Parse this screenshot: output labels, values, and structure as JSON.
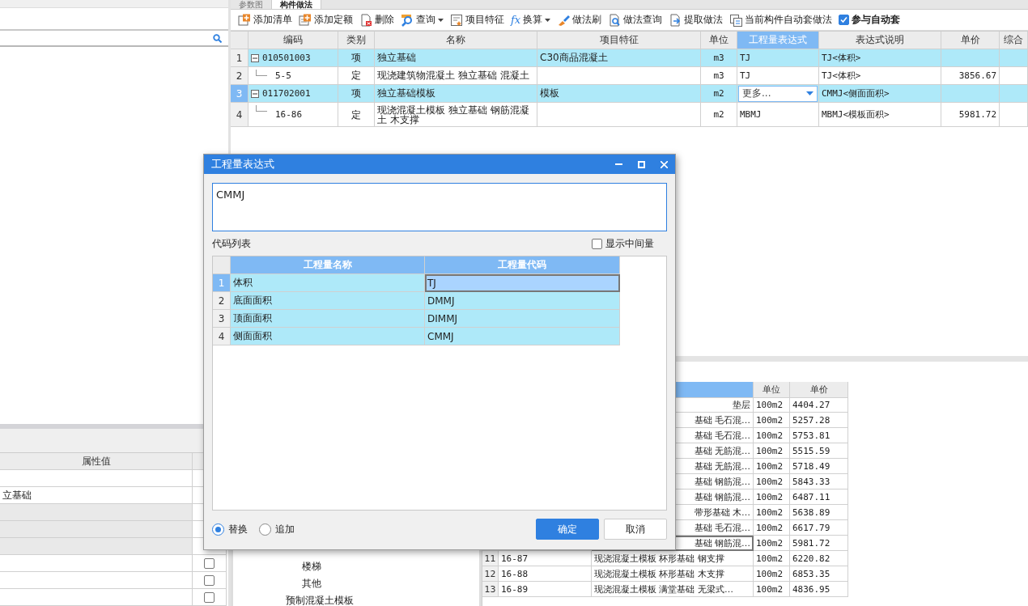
{
  "left_panel": {
    "property_table": {
      "columns": [
        {
          "label": "属性值"
        }
      ],
      "rows": [
        {
          "kind": "plain"
        },
        {
          "kind": "text",
          "value": "立基础"
        },
        {
          "kind": "shaded"
        },
        {
          "kind": "shaded"
        },
        {
          "kind": "shaded"
        },
        {
          "kind": "checkbox",
          "checked": false
        },
        {
          "kind": "checkbox",
          "checked": false
        },
        {
          "kind": "checkbox",
          "checked": false
        }
      ]
    }
  },
  "tabs": [
    {
      "label": "参数图",
      "selected": false
    },
    {
      "label": "构件做法",
      "selected": true
    }
  ],
  "toolbar": [
    {
      "label": "添加清单",
      "kind": "button"
    },
    {
      "label": "添加定额",
      "kind": "button"
    },
    {
      "label": "删除",
      "kind": "button"
    },
    {
      "label": "查询",
      "kind": "dropdown"
    },
    {
      "label": "项目特征",
      "kind": "button"
    },
    {
      "label": "换算",
      "kind": "dropdown",
      "icon_text": "fx"
    },
    {
      "label": "做法刷",
      "kind": "button"
    },
    {
      "label": "做法查询",
      "kind": "button"
    },
    {
      "label": "提取做法",
      "kind": "button"
    },
    {
      "label": "当前构件自动套做法",
      "kind": "button"
    },
    {
      "label": "参与自动套",
      "kind": "checkbox",
      "checked": true
    }
  ],
  "method_table": {
    "columns": [
      {
        "label": "编码",
        "selected": false
      },
      {
        "label": "类别",
        "selected": false
      },
      {
        "label": "名称",
        "selected": false
      },
      {
        "label": "项目特征",
        "selected": false
      },
      {
        "label": "单位",
        "selected": false
      },
      {
        "label": "工程量表达式",
        "selected": true
      },
      {
        "label": "表达式说明",
        "selected": false
      },
      {
        "label": "单价",
        "selected": false
      },
      {
        "label": "综合",
        "selected": false
      }
    ],
    "rows": [
      {
        "number": "1",
        "kind": "list",
        "expanded": true,
        "selected": false,
        "editing": false,
        "code": "010501003",
        "category": "项",
        "name": "独立基础",
        "feature": "C30商品混凝土",
        "unit": "m3",
        "expression": "TJ",
        "description": "TJ<体积>"
      },
      {
        "number": "2",
        "kind": "quota",
        "selected": false,
        "editing": false,
        "code": "5-5",
        "category": "定",
        "name": "现浇建筑物混凝土 独立基础 混凝土",
        "unit": "m3",
        "expression": "TJ",
        "description": "TJ<体积>",
        "price": "3856.67"
      },
      {
        "number": "3",
        "kind": "list",
        "expanded": true,
        "selected": true,
        "editing": true,
        "code": "011702001",
        "category": "项",
        "name": "独立基础模板",
        "feature": "模板",
        "unit": "m2",
        "expression": "更多...",
        "description": "CMMJ<侧面面积>"
      },
      {
        "number": "4",
        "kind": "quota",
        "selected": false,
        "editing": false,
        "code": "16-86",
        "category": "定",
        "name": "现浇混凝土模板 独立基础 钢筋混凝土 木支撑",
        "unit": "m2",
        "expression": "MBMJ",
        "description": "MBMJ<模板面积>",
        "price": "5981.72"
      }
    ]
  },
  "tree": [
    {
      "children": [
        {
          "label": "楼梯"
        },
        {
          "label": "其他"
        }
      ]
    },
    {
      "label": "预制混凝土模板"
    }
  ],
  "quota_table": {
    "columns": [
      {
        "label": "单位"
      },
      {
        "label": "单价"
      }
    ],
    "rows": [
      {
        "name": "垫层",
        "unit": "100m2",
        "price": "4404.27",
        "current": false
      },
      {
        "name": "基础 毛石混…",
        "unit": "100m2",
        "price": "5257.28",
        "current": false
      },
      {
        "name": "基础 毛石混…",
        "unit": "100m2",
        "price": "5753.81",
        "current": false
      },
      {
        "name": "基础 无筋混…",
        "unit": "100m2",
        "price": "5515.59",
        "current": false
      },
      {
        "name": "基础 无筋混…",
        "unit": "100m2",
        "price": "5718.49",
        "current": false
      },
      {
        "name": "基础 钢筋混…",
        "unit": "100m2",
        "price": "5843.33",
        "current": false
      },
      {
        "name": "基础 钢筋混…",
        "unit": "100m2",
        "price": "6487.11",
        "current": false
      },
      {
        "name": "带形基础 木…",
        "unit": "100m2",
        "price": "5638.89",
        "current": false
      },
      {
        "name": "基础 毛石混…",
        "unit": "100m2",
        "price": "6617.79",
        "current": false
      },
      {
        "name": "基础 钢筋混…",
        "unit": "100m2",
        "price": "5981.72",
        "current": true
      },
      {
        "number": "11",
        "code": "16-87",
        "name": "现浇混凝土模板 杯形基础 钢支撑",
        "unit": "100m2",
        "price": "6220.82",
        "current": false
      },
      {
        "number": "12",
        "code": "16-88",
        "name": "现浇混凝土模板 杯形基础 木支撑",
        "unit": "100m2",
        "price": "6853.35",
        "current": false
      },
      {
        "number": "13",
        "code": "16-89",
        "name": "现浇混凝土模板 满堂基础 无梁式…",
        "unit": "100m2",
        "price": "4836.95",
        "current": false
      }
    ]
  },
  "dialog": {
    "title": "工程量表达式",
    "expression": "CMMJ",
    "list_label": "代码列表",
    "show_intermediate": {
      "label": "显示中间量",
      "checked": false
    },
    "columns": [
      {
        "label": "工程量名称"
      },
      {
        "label": "工程量代码"
      }
    ],
    "rows": [
      {
        "number": "1",
        "name": "体积",
        "code": "TJ",
        "selected": true
      },
      {
        "number": "2",
        "name": "底面面积",
        "code": "DMMJ",
        "selected": false
      },
      {
        "number": "3",
        "name": "顶面面积",
        "code": "DIMMJ",
        "selected": false
      },
      {
        "number": "4",
        "name": "侧面面积",
        "code": "CMMJ",
        "selected": false
      }
    ],
    "modes": [
      {
        "label": "替换",
        "selected": true
      },
      {
        "label": "追加",
        "selected": false
      }
    ],
    "buttons": [
      {
        "label": "确定",
        "kind": "primary"
      },
      {
        "label": "取消",
        "kind": "secondary"
      }
    ]
  }
}
